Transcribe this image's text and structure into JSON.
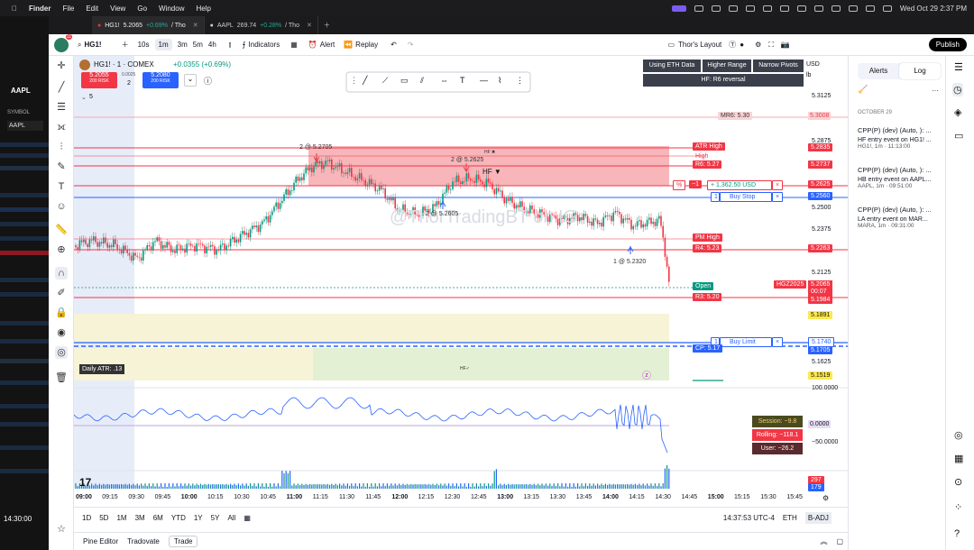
{
  "menubar": {
    "app": "Finder",
    "items": [
      "File",
      "Edit",
      "View",
      "Go",
      "Window",
      "Help"
    ],
    "datetime": "Wed Oct 29  2:37 PM"
  },
  "bg_window": {
    "symbol": "AAPL",
    "symbol_header": "SYMBOL",
    "symbol_field": "AAPL",
    "time": "14:30:00"
  },
  "browser_tabs": [
    {
      "title": "HG1!",
      "price": "5.2065",
      "change": "+0.69%",
      "suffix": "/ Tho"
    },
    {
      "title": "AAPL",
      "price": "269.74",
      "change": "+0.28%",
      "suffix": "/ Tho"
    }
  ],
  "toolbar": {
    "symbol": "HG1!",
    "intervals": [
      "10s",
      "1m",
      "3m",
      "5m",
      "4h"
    ],
    "active_interval": "1m",
    "indicators": "Indicators",
    "alert": "Alert",
    "replay": "Replay",
    "layout": "Thor's Layout",
    "publish": "Publish",
    "avatar_badge": "11"
  },
  "chart": {
    "title": "HG1! · 1 · COMEX",
    "change": "+0.0355 (+0.69%)",
    "sell_price": "5.2055",
    "sell_label": "200 RISK",
    "spread": "0.0025",
    "qty": "2",
    "buy_price": "5.2080",
    "buy_label": "200 RISK",
    "collapse_count": "5",
    "top_buttons": [
      "Using ETH Data",
      "Higher Range",
      "Narrow Pivots"
    ],
    "top_subtitle": "HF: R6 reversal",
    "currency": "USD",
    "unit": "lb",
    "watermark": "@ThorTradingBT on IG",
    "annotations": {
      "sell_high": "2 @ 5.2705",
      "sell_mid": "2 @ 5.2625",
      "buy_low": "2 @ 5.2605",
      "buy_late": "1 @ 5.2320",
      "hf_small": "HF ✖",
      "hf_big": "HF ▼",
      "hf_check": "HF✓"
    },
    "line_labels": {
      "mr6": "MR6: 5.30",
      "atr_high": "ATR High",
      "high": "High",
      "r6": "R6: 5.27",
      "pm_high": "PM High",
      "r4": "R4: 5.23",
      "open": "Open",
      "r3": "R3: 5.20",
      "cp": "CP: 5.17"
    },
    "order_lines": {
      "pct": "%",
      "minus1": "−1",
      "pnl": "+ 1,362.50 USD",
      "buy_stop_qty": "1",
      "buy_stop": "Buy Stop",
      "buy_limit_qty": "1",
      "buy_limit": "Buy Limit",
      "close": "×"
    },
    "daily_atr": "Daily ATR: .13",
    "stats": {
      "session": "Session: −9.8",
      "rolling": "Rolling: −118.1",
      "user": "User: −26.2"
    },
    "price_ticks": [
      "5.3125",
      "5.2875",
      "5.2500",
      "5.2375",
      "5.2125",
      "5.1625"
    ],
    "price_tags": {
      "mr6": "5.3008",
      "atr": "5.2835",
      "r6": "5.2737",
      "pnl": "5.2625",
      "stop": "5.2560",
      "r4": "5.2263",
      "sym": "HGZ2025",
      "last": "5.2065",
      "countdown": "00:07",
      "r3": "5.1984",
      "y1": "5.1891",
      "limit": "5.1740",
      "cp": "5.1705",
      "y2": "5.1519"
    },
    "osc_ticks": [
      "100.0000",
      "0.0000",
      "−50.0000"
    ],
    "vol_tags": [
      "297",
      "179"
    ],
    "time_ticks": [
      "09:00",
      "09:15",
      "09:30",
      "09:45",
      "10:00",
      "10:15",
      "10:30",
      "10:45",
      "11:00",
      "11:15",
      "11:30",
      "11:45",
      "12:00",
      "12:15",
      "12:30",
      "12:45",
      "13:00",
      "13:15",
      "13:30",
      "13:45",
      "14:00",
      "14:15",
      "14:30",
      "14:45",
      "15:00",
      "15:15",
      "15:30",
      "15:45"
    ],
    "bold_times": [
      "09:00",
      "10:00",
      "11:00",
      "12:00",
      "13:00",
      "14:00",
      "15:00"
    ]
  },
  "bottombar": {
    "ranges": [
      "1D",
      "5D",
      "1M",
      "3M",
      "6M",
      "YTD",
      "1Y",
      "5Y",
      "All"
    ],
    "clock": "14:37:53 UTC-4",
    "session": "ETH",
    "adj": "B-ADJ"
  },
  "footer": {
    "tabs": [
      "Pine Editor",
      "Tradovate",
      "Trade"
    ]
  },
  "right_panel": {
    "tabs": [
      "Alerts",
      "Log"
    ],
    "active": "Log",
    "date": "OCTOBER 29",
    "log": [
      {
        "title": "CPP(P) (dev) (Auto, ): ...",
        "body": "HF entry event on HG1! ...",
        "sym": "HG1!, 1m",
        "time": "11:13:00"
      },
      {
        "title": "CPP(P) (dev) (Auto, ): ...",
        "body": "HB entry event on AAPL...",
        "sym": "AAPL, 1m",
        "time": "09:51:00"
      },
      {
        "title": "CPP(P) (dev) (Auto, ): ...",
        "body": "LA entry event on MAR...",
        "sym": "MARA, 1m",
        "time": "09:31:00"
      }
    ]
  },
  "colors": {
    "red": "#f23645",
    "green": "#089981",
    "blue": "#2962ff",
    "yellow_zone": "#f7f3d6",
    "green_zone": "#e3f0d4",
    "red_zone": "#f7a9ae"
  }
}
